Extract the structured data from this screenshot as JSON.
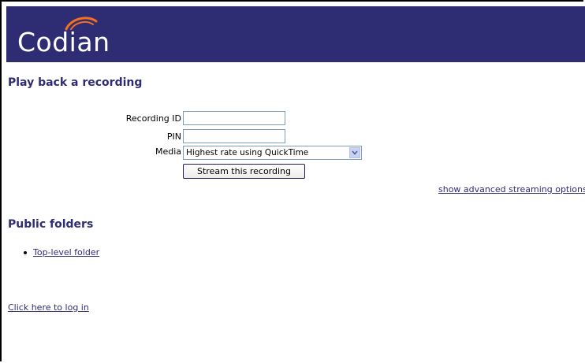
{
  "header": {
    "logo_text": "Codian"
  },
  "playback": {
    "title": "Play back a recording",
    "recording_id_label": "Recording ID",
    "recording_id_value": "",
    "pin_label": "PIN",
    "pin_value": "",
    "media_label": "Media",
    "media_selected": "Highest rate using QuickTime",
    "stream_button": "Stream this recording",
    "advanced_link": "show advanced streaming options"
  },
  "public_folders": {
    "title": "Public folders",
    "items": [
      {
        "label": "Top-level folder"
      }
    ]
  },
  "footer": {
    "login_link": "Click here to log in"
  },
  "colors": {
    "banner": "#2e2d73",
    "heading": "#2e2d73",
    "logo_arc": "#f37021",
    "link": "#2e2d73"
  }
}
